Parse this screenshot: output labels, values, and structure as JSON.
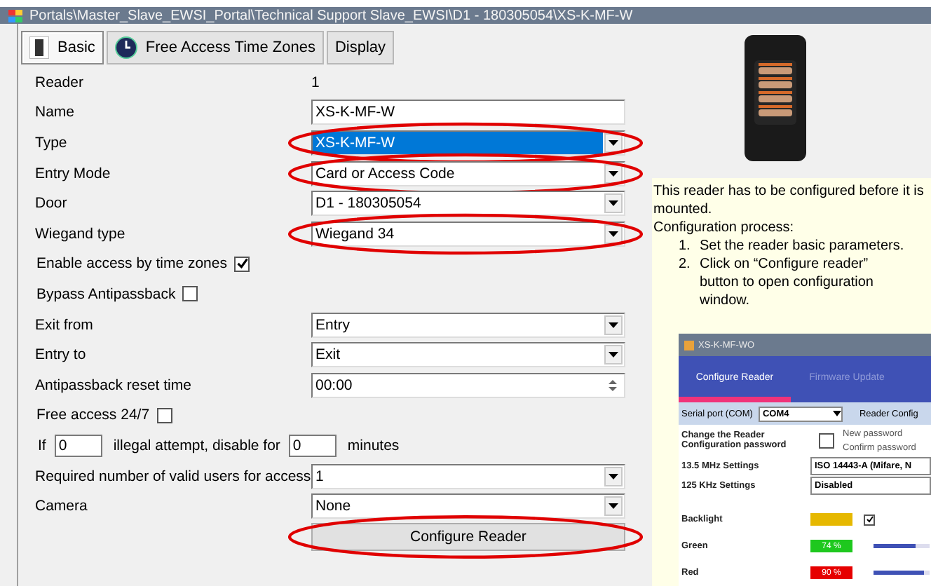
{
  "window": {
    "title": "Portals\\Master_Slave_EWSI_Portal\\Technical Support Slave_EWSI\\D1 - 180305054\\XS-K-MF-W"
  },
  "tabs": [
    {
      "label": "Basic",
      "selected": true
    },
    {
      "label": "Free Access Time Zones",
      "selected": false
    },
    {
      "label": "Display",
      "selected": false
    }
  ],
  "form": [
    {
      "kind": "value",
      "label": "Reader",
      "value": "1"
    },
    {
      "kind": "input",
      "label": "Name",
      "value": "XS-K-MF-W"
    },
    {
      "kind": "select",
      "label": "Type",
      "value": "XS-K-MF-W",
      "focused": true,
      "circled": true
    },
    {
      "kind": "select",
      "label": "Entry Mode",
      "value": "Card or Access Code",
      "focused": false,
      "circled": true
    },
    {
      "kind": "select",
      "label": "Door",
      "value": "D1 - 180305054",
      "focused": false,
      "circled": false
    },
    {
      "kind": "select",
      "label": "Wiegand type",
      "value": "Wiegand 34",
      "focused": false,
      "circled": true
    },
    {
      "kind": "checkbox",
      "label": "Enable access by time zones",
      "checked": true
    },
    {
      "kind": "checkbox",
      "label": "Bypass Antipassback",
      "checked": false
    },
    {
      "kind": "select",
      "label": "Exit from",
      "value": "Entry",
      "focused": false,
      "circled": false
    },
    {
      "kind": "select",
      "label": "Entry to",
      "value": "Exit",
      "focused": false,
      "circled": false
    },
    {
      "kind": "time",
      "label": "Antipassback reset time",
      "value": "00:00"
    },
    {
      "kind": "checkbox",
      "label": "Free access 24/7",
      "checked": false
    },
    {
      "kind": "attempts",
      "label": "If",
      "value": "0",
      "middle": "illegal attempt, disable for",
      "value2": "0",
      "suffix": "minutes"
    },
    {
      "kind": "select",
      "label": "Required number of valid users for access",
      "value": "1",
      "focused": false,
      "circled": false
    },
    {
      "kind": "select",
      "label": "Camera",
      "value": "None",
      "focused": false,
      "circled": false
    },
    {
      "kind": "button",
      "label": "Configure Reader",
      "circled": true
    }
  ],
  "help": {
    "intro": "This reader has to be configured before it is mounted.",
    "heading": "Configuration process:",
    "steps": [
      {
        "number": "1.",
        "text": "Set the reader basic parameters."
      },
      {
        "number": "2.",
        "text": "Click on “Configure reader” button to open configuration window."
      }
    ]
  },
  "config_window": {
    "title": "XS-K-MF-WO",
    "tabs": [
      {
        "label": "Configure Reader",
        "selected": true
      },
      {
        "label": "Firmware Update",
        "selected": false
      }
    ],
    "port_label": "Serial port (COM)",
    "port": "COM4",
    "reader_config": "Reader Config",
    "password_label": "Change the Reader Configuration password",
    "password_checked": false,
    "new_password": "New password",
    "confirm_password": "Confirm password",
    "mhz_label": "13.5 MHz Settings",
    "mhz_value": "ISO 14443-A (Mifare, N",
    "khz_label": "125 KHz Settings",
    "khz_value": "Disabled",
    "lights": [
      {
        "label": "Backlight",
        "color": "#e6b800",
        "checked": true
      },
      {
        "label": "Green",
        "color": "#1ec81e",
        "reading": "74 %",
        "level": 0.74
      },
      {
        "label": "Red",
        "color": "#e60000",
        "reading": "90 %",
        "level": 0.9
      }
    ]
  }
}
